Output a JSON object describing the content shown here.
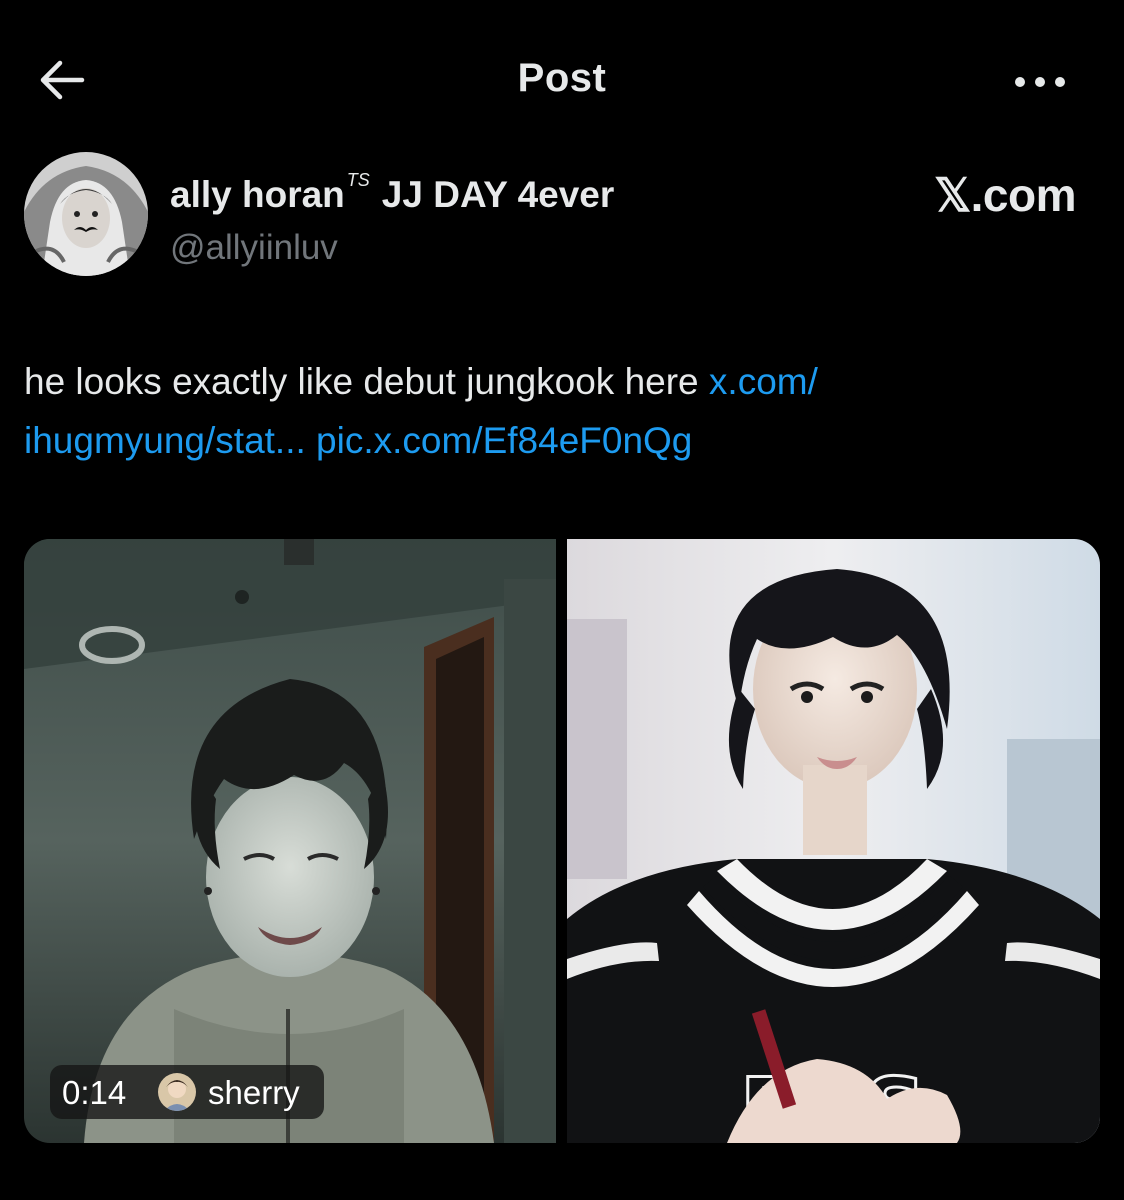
{
  "header": {
    "title": "Post",
    "back_icon": "arrow-left-icon",
    "more_icon": "more-dots-icon"
  },
  "author": {
    "display_name": "ally horan",
    "name_badge": "TS",
    "name_suffix": "JJ DAY 4ever",
    "handle": "@allyiinluv",
    "site_label": "𝕏.com"
  },
  "post": {
    "text": "he looks exactly like debut jungkook here",
    "link1_part1": "x.com/",
    "link1_part2": "ihugmyung/stat...",
    "link2": "pic.x.com/Ef84eF0nQg"
  },
  "media": {
    "video": {
      "duration": "0:14",
      "user": "sherry"
    },
    "photo_shirt_text": "BTS"
  },
  "colors": {
    "background": "#000000",
    "text": "#e7e9ea",
    "secondary": "#71767b",
    "link": "#1d9bf0"
  }
}
